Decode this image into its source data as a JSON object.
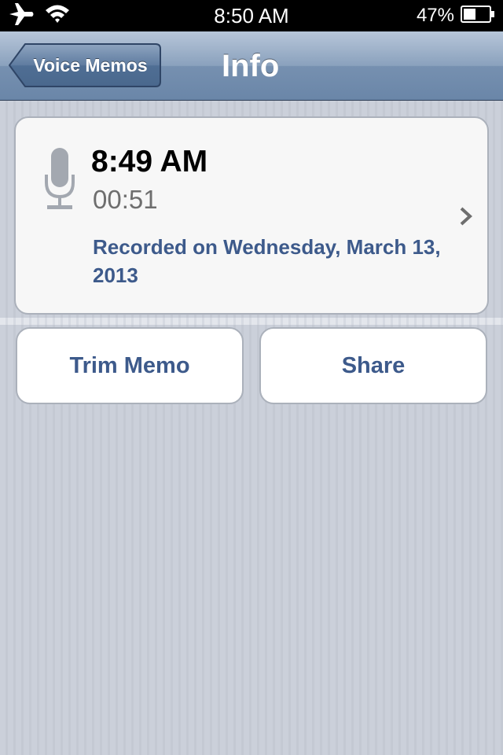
{
  "status_bar": {
    "time": "8:50 AM",
    "battery_percent": "47%",
    "icons": [
      "airplane-icon",
      "wifi-icon",
      "battery-icon"
    ]
  },
  "nav_bar": {
    "back_label": "Voice Memos",
    "title": "Info"
  },
  "memo": {
    "time": "8:49 AM",
    "duration": "00:51",
    "recorded_on": "Recorded on Wednesday, March 13, 2013",
    "icon": "microphone-icon"
  },
  "actions": {
    "trim_label": "Trim Memo",
    "share_label": "Share"
  },
  "colors": {
    "accent_text": "#3d5a8b",
    "nav_bar": "#7690b0",
    "background": "#c8ccd6"
  }
}
